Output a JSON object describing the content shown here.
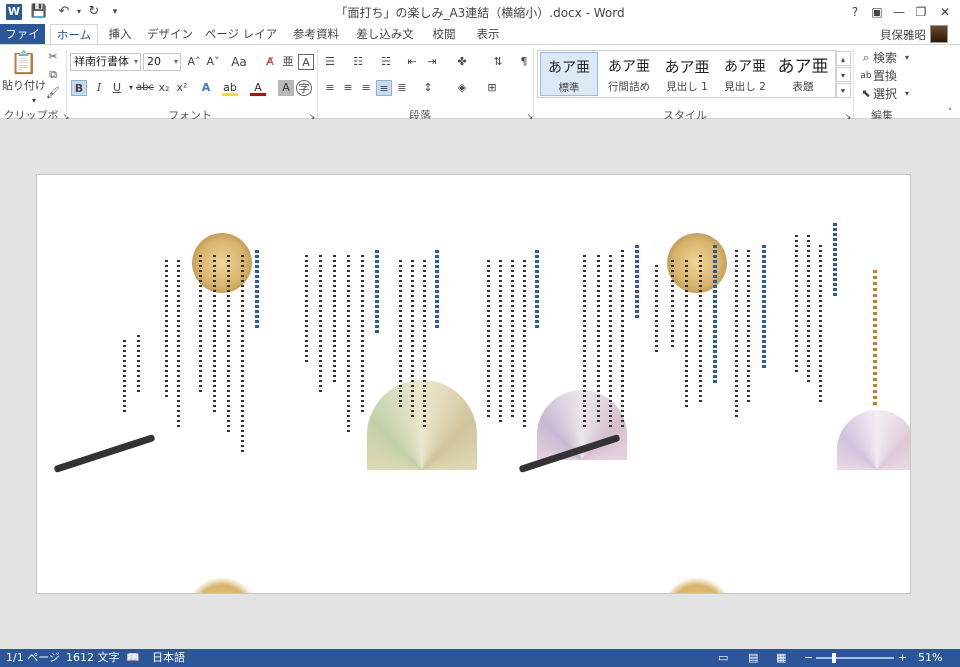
{
  "app": {
    "title": "「面打ち」の楽しみ_A3連結（横縮小）.docx - Word",
    "logo_letter": "W",
    "help": "?",
    "user_name": "貝保雅昭"
  },
  "tabs": [
    "ファイル",
    "ホーム",
    "挿入",
    "デザイン",
    "ページ レイアウト",
    "参考資料",
    "差し込み文書",
    "校閲",
    "表示"
  ],
  "ribbon": {
    "clipboard": {
      "paste_label": "貼り付け",
      "group": "クリップボード"
    },
    "font": {
      "font_name": "祥南行書体",
      "font_size": "20",
      "case_label": "Aa",
      "bold": "B",
      "italic": "I",
      "underline": "U",
      "strike": "abc",
      "subscript": "x₂",
      "superscript": "x²",
      "group": "フォント"
    },
    "paragraph": {
      "group": "段落"
    },
    "styles": {
      "items": [
        {
          "sample": "あア亜",
          "name": "標準"
        },
        {
          "sample": "あア亜",
          "name": "行間詰め"
        },
        {
          "sample": "あア亜",
          "name": "見出し 1"
        },
        {
          "sample": "あア亜",
          "name": "見出し 2"
        },
        {
          "sample": "あア亜",
          "name": "表題"
        }
      ],
      "group": "スタイル"
    },
    "editing": {
      "find": "検索",
      "replace": "置換",
      "select": "選択",
      "group": "編集"
    }
  },
  "status": {
    "page": "1/1 ページ",
    "words": "1612 文字",
    "language": "日本語",
    "zoom": "51%"
  },
  "colors": {
    "accent": "#2b579a",
    "heading_blue": "#2b5aa8",
    "title_orange": "#d97a1a"
  }
}
